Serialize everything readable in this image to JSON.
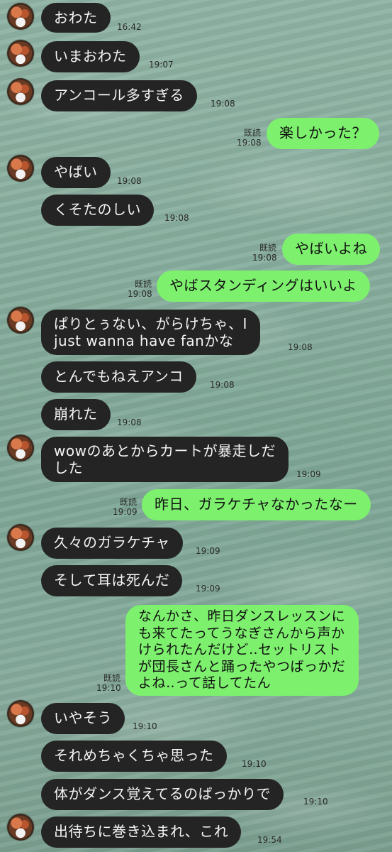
{
  "messages": [
    {
      "side": "in",
      "text": "おわた",
      "time": "16:42",
      "avatar": true
    },
    {
      "side": "in",
      "text": "いまおわた",
      "time": "19:07",
      "avatar": true
    },
    {
      "side": "in",
      "text": "アンコール多すぎる",
      "time": "19:08",
      "avatar": true
    },
    {
      "side": "out",
      "text": "楽しかった？",
      "time": "19:08",
      "read": "既読"
    },
    {
      "side": "in",
      "text": "やばい",
      "time": "19:08",
      "avatar": true
    },
    {
      "side": "in",
      "text": "くそたのしい",
      "time": "19:08"
    },
    {
      "side": "out",
      "text": "やばいよね",
      "time": "19:08",
      "read": "既読"
    },
    {
      "side": "out",
      "text": "やばスタンディングはいいよ",
      "time": "19:08",
      "read": "既読"
    },
    {
      "side": "in",
      "text": "ぱりとぅない、がらけちゃ、I\njust wanna have fanかな",
      "time": "19:08",
      "avatar": true
    },
    {
      "side": "in",
      "text": "とんでもねえアンコ",
      "time": "19:08"
    },
    {
      "side": "in",
      "text": "崩れた",
      "time": "19:08"
    },
    {
      "side": "in",
      "text": "wowのあとからカートが暴走しだ\nした",
      "time": "19:09",
      "avatar": true
    },
    {
      "side": "out",
      "text": "昨日、ガラケチャなかったなー",
      "time": "19:09",
      "read": "既読"
    },
    {
      "side": "in",
      "text": "久々のガラケチャ",
      "time": "19:09",
      "avatar": true
    },
    {
      "side": "in",
      "text": "そして耳は死んだ",
      "time": "19:09"
    },
    {
      "side": "out",
      "text": "なんかさ、昨日ダンスレッスンに\nも来てたってうなぎさんから声か\nけられたんだけど‥セットリスト\nが団長さんと踊ったやつばっかだ\nよね‥って話してたん",
      "time": "19:10",
      "read": "既読"
    },
    {
      "side": "in",
      "text": "いやそう",
      "time": "19:10",
      "avatar": true
    },
    {
      "side": "in",
      "text": "それめちゃくちゃ思った",
      "time": "19:10"
    },
    {
      "side": "in",
      "text": "体がダンス覚えてるのばっかりで",
      "time": "19:10"
    },
    {
      "side": "in",
      "text": "出待ちに巻き込まれ、これ",
      "time": "19:54",
      "avatar": true
    }
  ]
}
